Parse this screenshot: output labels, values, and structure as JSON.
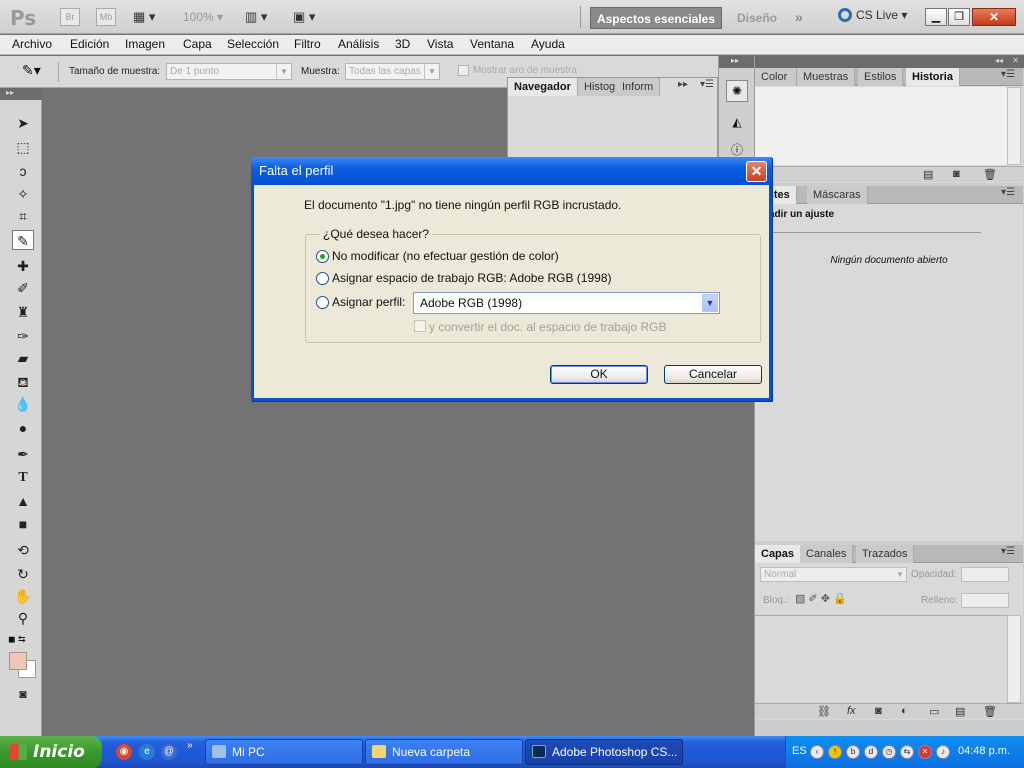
{
  "app": {
    "logo": "Ps",
    "bridge": "Br",
    "minibridge": "Mb",
    "zoom": "100%",
    "workspace_active": "Aspectos esenciales",
    "workspace_design": "Diseño",
    "more": "»",
    "cslive": "CS Live"
  },
  "menubar": [
    "Archivo",
    "Edición",
    "Imagen",
    "Capa",
    "Selección",
    "Filtro",
    "Análisis",
    "3D",
    "Vista",
    "Ventana",
    "Ayuda"
  ],
  "options": {
    "sample_size_label": "Tamaño de muestra:",
    "sample_size_value": "De 1 punto",
    "sample_label": "Muestra:",
    "sample_value": "Todas las capas",
    "show_ring": "Mostrar aro de muestra"
  },
  "nav_panel": {
    "tabs": [
      "Navegador",
      "Histog",
      "Inform"
    ]
  },
  "dock": {
    "top_tabs": [
      "Color",
      "Muestras",
      "Estilos",
      "Historia"
    ],
    "adj_tabs": [
      "ustes",
      "Máscaras"
    ],
    "adj_title": "adir un ajuste",
    "adj_empty": "Ningún documento abierto",
    "layers_tabs": [
      "Capas",
      "Canales",
      "Trazados"
    ],
    "blend_mode": "Normal",
    "opacity_label": "Opacidad:",
    "lock_label": "Bloq.:",
    "fill_label": "Relleno:"
  },
  "dialog": {
    "title": "Falta el perfil",
    "message": "El documento \"1.jpg\" no tiene ningún perfil RGB incrustado.",
    "group_title": "¿Qué desea hacer?",
    "option1": "No modificar (no efectuar gestión de color)",
    "option2": "Asignar espacio de trabajo RGB: Adobe RGB (1998)",
    "option3": "Asignar perfil:",
    "profile_value": "Adobe RGB (1998)",
    "convert_label": "y convertir el doc. al espacio de trabajo RGB",
    "ok": "OK",
    "cancel": "Cancelar"
  },
  "taskbar": {
    "start": "Inicio",
    "tasks": [
      "Mi PC",
      "Nueva carpeta",
      "Adobe Photoshop CS..."
    ],
    "lang": "ES",
    "time": "04:48 p.m."
  }
}
